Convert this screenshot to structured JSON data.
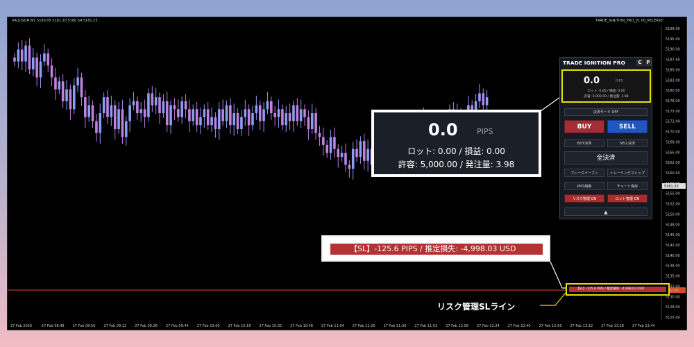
{
  "header": {
    "symbol_info": "XAUUSD#,M1  5180.05 5181.20 5180.54 5181.23",
    "indicator_name": "TRADE_IGNITION_PRO_V1.00_RELEASE"
  },
  "price_axis": {
    "labels": [
      "5199.00",
      "5195.00",
      "5190.00",
      "5187.60",
      "5185.00",
      "5183.00",
      "5180.00",
      "5178.00",
      "5175.00",
      "5172.00",
      "5170.00",
      "5168.00",
      "5165.00",
      "5162.00",
      "5160.00",
      "5158.00",
      "5155.00",
      "5152.00",
      "5150.00",
      "5148.00",
      "5145.00",
      "5142.00",
      "5140.00",
      "5138.00",
      "5135.00",
      "5132.00",
      "5130.00",
      "5128.00",
      "5125.00"
    ],
    "current_price": "5181.23",
    "sl_price": "5162.00"
  },
  "time_axis": {
    "labels": [
      "27 Feb 2026",
      "27 Feb 08:48",
      "27 Feb 08:56",
      "27 Feb 09:12",
      "27 Feb 09:28",
      "27 Feb 09:44",
      "27 Feb 10:00",
      "27 Feb 10:16",
      "27 Feb 10:32",
      "27 Feb 10:48",
      "27 Feb 11:04",
      "27 Feb 11:20",
      "27 Feb 11:36",
      "27 Feb 11:52",
      "27 Feb 12:08",
      "27 Feb 12:24",
      "27 Feb 12:40",
      "27 Feb 12:56",
      "27 Feb 13:12",
      "27 Feb 13:28",
      "27 Feb 13:44"
    ]
  },
  "chart_data": {
    "type": "candlestick",
    "close": [
      5190,
      5193,
      5190,
      5194,
      5188,
      5191,
      5186,
      5190,
      5192,
      5189,
      5186,
      5183,
      5185,
      5180,
      5183,
      5178,
      5184,
      5186,
      5181,
      5176,
      5179,
      5175,
      5172,
      5177,
      5181,
      5176,
      5179,
      5173,
      5178,
      5171,
      5175,
      5179,
      5180,
      5177,
      5178,
      5176,
      5182,
      5179,
      5181,
      5177,
      5180,
      5174,
      5179,
      5178,
      5176,
      5180,
      5178,
      5175,
      5178,
      5174,
      5176,
      5178,
      5174,
      5176,
      5173,
      5178,
      5175,
      5179,
      5174,
      5177,
      5173,
      5176,
      5178,
      5174,
      5177,
      5179,
      5175,
      5178,
      5180,
      5177,
      5176,
      5178,
      5174,
      5177,
      5175,
      5179,
      5175,
      5178,
      5176,
      5173,
      5177,
      5172,
      5171,
      5169,
      5167,
      5171,
      5168,
      5166,
      5167,
      5164,
      5163,
      5168,
      5166,
      5170,
      5165,
      5168,
      5164,
      5167,
      5169,
      5166,
      5171,
      5168,
      5165,
      5172,
      5169,
      5174,
      5170,
      5175,
      5172,
      5176,
      5170,
      5174,
      5171,
      5175,
      5173,
      5170,
      5175,
      5178,
      5174,
      5177,
      5173,
      5176,
      5179,
      5176,
      5180,
      5182,
      5179,
      5181
    ]
  },
  "panel": {
    "title": "TRADE IGNITION PRO",
    "btn_c": "C",
    "btn_p": "P",
    "pips_value": "0.0",
    "pips_unit": "PIPS",
    "lot_line": "ロット: 0.00 / 損益: 0.00",
    "allow_line": "許容: 5,000.00 / 発注量: 3.98",
    "mode_btn": "決済モード OFF",
    "buy": "BUY",
    "sell": "SELL",
    "buy_close": "BUY決済",
    "sell_close": "SELL決済",
    "all_close": "全決済",
    "breakeven": "ブレークイーブン",
    "trailing": "トレーリングストップ",
    "pips_btn": "PIPS制御",
    "chart_save": "チャート保存",
    "risk_mgmt": "リスク管理 ON",
    "lot_mgmt": "ロット管理 ON",
    "collapse": "▲"
  },
  "callout": {
    "pips_value": "0.0",
    "pips_unit": "PIPS",
    "lot_line": "ロット: 0.00 / 損益: 0.00",
    "allow_line": "許容: 5,000.00 / 発注量: 3.98"
  },
  "sl_line": {
    "text": "【SL】-125.6 PIPS / 推定損失: -4,998.03 USD",
    "label": "リスク管理SLライン"
  },
  "colors": {
    "bull": "#8a9df5",
    "bear": "#c080e0",
    "sl_line": "#d94a2e",
    "accent_yellow": "#e6e000"
  }
}
